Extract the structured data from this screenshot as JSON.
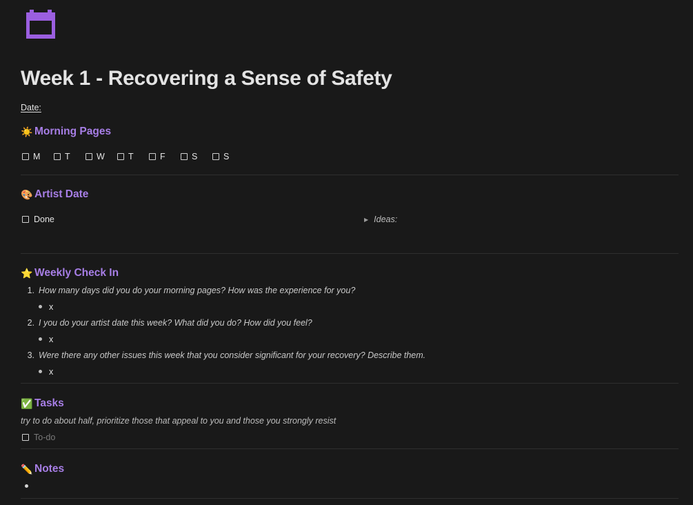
{
  "page": {
    "icon": "calendar-icon",
    "title": "Week 1 - Recovering a Sense of Safety",
    "date_label": "Date:"
  },
  "colors": {
    "accent": "#a77ee6",
    "background": "#191919"
  },
  "morning_pages": {
    "emoji": "☀️",
    "heading": "Morning Pages",
    "days": [
      "M",
      "T",
      "W",
      "T",
      "F",
      "S",
      "S"
    ]
  },
  "artist_date": {
    "emoji": "🎨",
    "heading": "Artist Date",
    "done_label": "Done",
    "ideas_label": "Ideas:"
  },
  "weekly_check_in": {
    "emoji": "⭐",
    "heading": "Weekly Check In",
    "questions": [
      {
        "num": "1.",
        "text": "How many days did you do your morning pages?  How was the experience for you?",
        "answer": "x"
      },
      {
        "num": "2.",
        "text": "I you do your artist date this week?  What did you do?  How did you feel?",
        "answer": "x"
      },
      {
        "num": "3.",
        "text": "Were there any other issues this week that you consider significant for your recovery?  Describe them.",
        "answer": "x"
      }
    ]
  },
  "tasks": {
    "emoji": "✅",
    "heading": "Tasks",
    "note": "try to do about half, prioritize those that appeal to you and those you strongly resist",
    "todo_placeholder": "To-do"
  },
  "notes": {
    "emoji": "✏️",
    "heading": "Notes"
  }
}
